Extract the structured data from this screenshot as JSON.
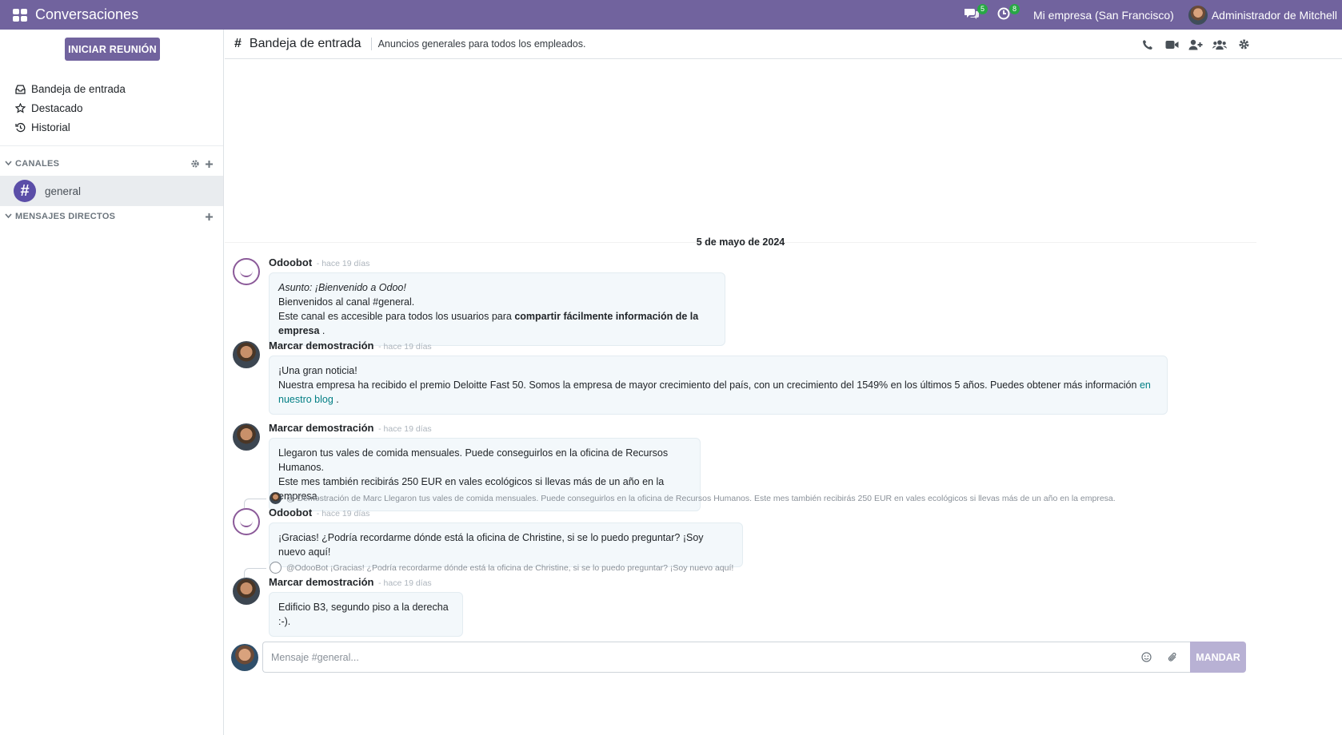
{
  "topbar": {
    "app_title": "Conversaciones",
    "messages_badge": "5",
    "activities_badge": "8",
    "company": "Mi empresa (San Francisco)",
    "user_name": "Administrador de Mitchell"
  },
  "sidebar": {
    "start_meeting": "INICIAR REUNIÓN",
    "nav": [
      {
        "label": "Bandeja de entrada",
        "icon": "inbox-icon"
      },
      {
        "label": "Destacado",
        "icon": "star-icon"
      },
      {
        "label": "Historial",
        "icon": "history-icon"
      }
    ],
    "channels_label": "CANALES",
    "channels": [
      {
        "name": "general"
      }
    ],
    "direct_label": "MENSAJES DIRECTOS"
  },
  "header": {
    "hash": "#",
    "thread_name": "Bandeja de entrada",
    "description": "Anuncios generales para todos los empleados."
  },
  "date_separator": "5 de mayo de 2024",
  "messages": [
    {
      "author": "Odoobot",
      "time": "- hace 19 días",
      "subject": "Asunto: ¡Bienvenido a Odoo!",
      "line1": "Bienvenidos al canal #general.",
      "line2_pre": "Este canal es accesible para todos los usuarios para ",
      "line2_bold": "compartir fácilmente información de la empresa",
      "line2_post": " ."
    },
    {
      "author": "Marcar demostración",
      "time": "- hace 19 días",
      "line1": "¡Una gran noticia!",
      "line2": "Nuestra empresa ha recibido el premio Deloitte Fast 50. Somos la empresa de mayor crecimiento del país, con un crecimiento del 1549% en los últimos 5 años. Puedes obtener más información ",
      "link": "en nuestro blog",
      "line2_post": " ."
    },
    {
      "author": "Marcar demostración",
      "time": "- hace 19 días",
      "line1": "Llegaron tus vales de comida mensuales. Puede conseguirlos en la oficina de Recursos Humanos.",
      "line2": "Este mes también recibirás 250 EUR en vales ecológicos si llevas más de un año en la empresa."
    },
    {
      "reply_ref": "@ Demostración de Marc Llegaron tus vales de comida mensuales. Puede conseguirlos en la oficina de Recursos Humanos. Este mes también recibirás 250 EUR en vales ecológicos si llevas más de un año en la empresa.",
      "author": "Odoobot",
      "time": "- hace 19 días",
      "line1": "¡Gracias! ¿Podría recordarme dónde está la oficina de Christine, si se lo puedo preguntar? ¡Soy nuevo aquí!"
    },
    {
      "reply_ref": "@OdooBot ¡Gracias! ¿Podría recordarme dónde está la oficina de Christine, si se lo puedo preguntar? ¡Soy nuevo aquí!",
      "author": "Marcar demostración",
      "time": "- hace 19 días",
      "line1": "Edificio B3, segundo piso a la derecha :-)."
    }
  ],
  "composer": {
    "placeholder": "Mensaje #general...",
    "send_label": "MANDAR"
  },
  "colors": {
    "brand": "#71639e",
    "badge": "#28a745",
    "bubble_bg": "#f3f8fb",
    "link": "#017e84",
    "send_disabled": "#b8b1d4"
  }
}
